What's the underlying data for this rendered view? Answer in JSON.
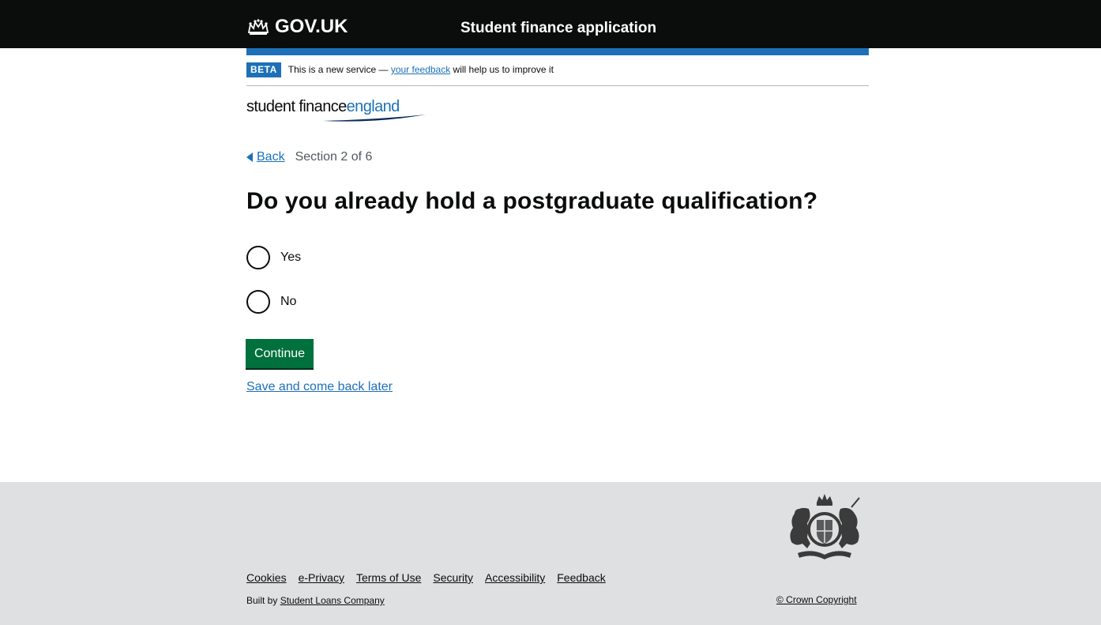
{
  "header": {
    "logo_text": "GOV.UK",
    "service_name": "Student finance application"
  },
  "phase_banner": {
    "tag": "BETA",
    "text_before": "This is a new service — ",
    "link_text": "your feedback",
    "text_after": " will help us to improve it"
  },
  "brand": {
    "word1": "student finance",
    "word2": "england"
  },
  "nav": {
    "back_label": "Back",
    "section_text": "Section 2 of 6"
  },
  "question": {
    "heading": "Do you already hold a postgraduate qualification?",
    "options": [
      {
        "label": "Yes"
      },
      {
        "label": "No"
      }
    ]
  },
  "actions": {
    "continue_label": "Continue",
    "save_label": "Save and come back later"
  },
  "footer": {
    "links": [
      "Cookies",
      "e-Privacy",
      "Terms of Use",
      "Security",
      "Accessibility",
      "Feedback"
    ],
    "built_by_prefix": "Built by ",
    "built_by_link": "Student Loans Company",
    "copyright": "© Crown Copyright"
  },
  "colors": {
    "header_bg": "#0b0c0c",
    "accent_blue": "#1d70b8",
    "button_green": "#00703c",
    "footer_bg": "#dee0e2"
  }
}
